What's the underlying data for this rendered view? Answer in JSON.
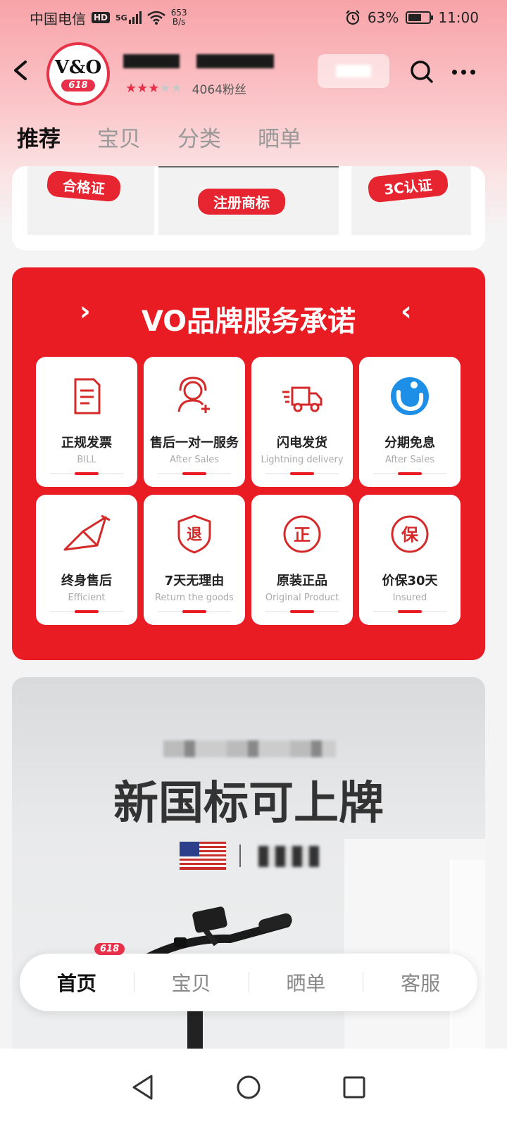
{
  "status_bar": {
    "carrier": "中国电信",
    "hd": "HD",
    "network": "5G",
    "speed_value": "653",
    "speed_unit": "B/s",
    "battery": "63%",
    "battery_level": 0.63,
    "time": "11:00"
  },
  "header": {
    "logo_text": "V&O",
    "logo_badge": "618",
    "rating_stars": 3,
    "rating_max": 5,
    "fans": "4064粉丝"
  },
  "tabs": [
    {
      "label": "推荐",
      "active": true
    },
    {
      "label": "宝贝",
      "active": false
    },
    {
      "label": "分类",
      "active": false
    },
    {
      "label": "晒单",
      "active": false
    }
  ],
  "certificates": {
    "items": [
      "合格证",
      "注册商标",
      "3C认证"
    ]
  },
  "promise": {
    "title": "VO品牌服务承诺",
    "items": [
      {
        "zh": "正规发票",
        "en": "BILL",
        "icon": "invoice-icon"
      },
      {
        "zh": "售后一对一服务",
        "en": "After Sales",
        "icon": "support-person-icon"
      },
      {
        "zh": "闪电发货",
        "en": "Lightning delivery",
        "icon": "delivery-truck-icon"
      },
      {
        "zh": "分期免息",
        "en": "After Sales",
        "icon": "installment-icon"
      },
      {
        "zh": "终身售后",
        "en": "Efficient",
        "icon": "bike-frame-icon"
      },
      {
        "zh": "7天无理由",
        "en": "Return the goods",
        "icon": "return-icon"
      },
      {
        "zh": "原装正品",
        "en": "Original Product",
        "icon": "genuine-icon"
      },
      {
        "zh": "价保30天",
        "en": "Insured",
        "icon": "price-protect-icon"
      }
    ]
  },
  "banner": {
    "title": "新国标可上牌"
  },
  "bottom_nav": {
    "badge": "618",
    "items": [
      {
        "label": "首页",
        "active": true
      },
      {
        "label": "宝贝",
        "active": false
      },
      {
        "label": "晒单",
        "active": false
      },
      {
        "label": "客服",
        "active": false
      }
    ]
  },
  "colors": {
    "brand_red": "#e81c22",
    "badge_red": "#e8304a"
  }
}
